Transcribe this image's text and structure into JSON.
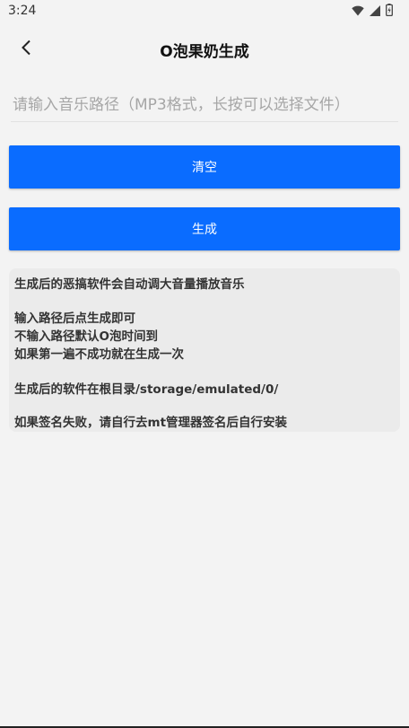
{
  "status_bar": {
    "time": "3:24",
    "icons": [
      "wifi-icon",
      "cellular-signal-icon",
      "battery-icon"
    ]
  },
  "app_bar": {
    "title": "O泡果奶生成",
    "back_icon": "chevron-left-icon"
  },
  "form": {
    "path_input_value": "",
    "path_input_placeholder": "请输入音乐路径（MP3格式，长按可以选择文件）",
    "clear_label": "清空",
    "generate_label": "生成"
  },
  "info": {
    "lines": [
      "生成后的恶搞软件会自动调大音量播放音乐",
      "输入路径后点生成即可",
      "不输入路径默认O泡时间到",
      "如果第一遍不成功就在生成一次",
      "生成后的软件在根目录/storage/emulated/0/",
      "如果签名失败，请自行去mt管理器签名后自行安装"
    ]
  },
  "colors": {
    "accent": "#0a6cff",
    "background": "#f3f3f3",
    "card": "#ebebeb"
  }
}
